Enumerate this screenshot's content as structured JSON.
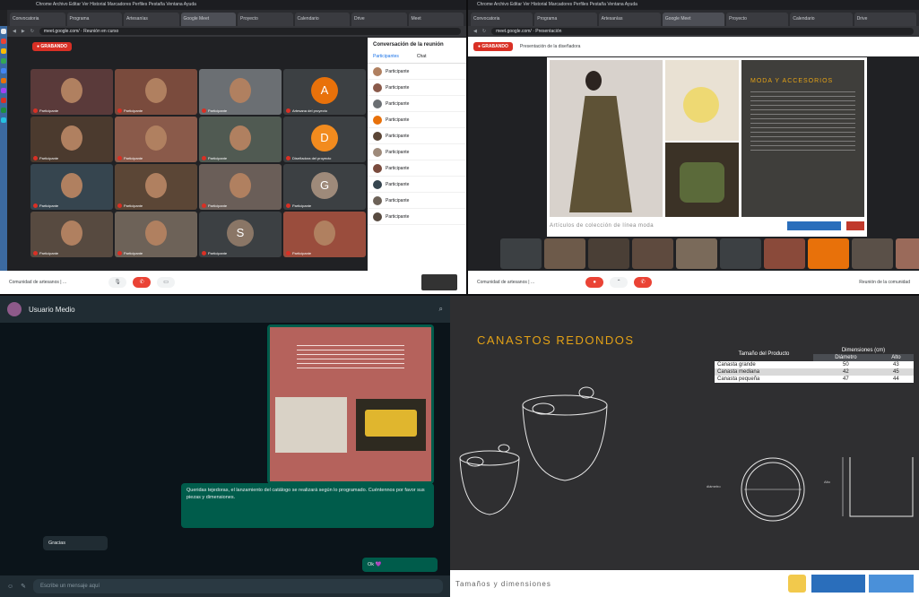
{
  "colors": {
    "accent": "#d93025",
    "chat_out": "#005c4b",
    "slide_title": "#e4a216"
  },
  "q1": {
    "menubar": "Chrome   Archivo   Editar   Ver   Historial   Marcadores   Perfiles   Pestaña   Ventana   Ayuda",
    "tabs": [
      "Convocatoria",
      "Programa",
      "Artesanías",
      "Google Meet",
      "Proyecto",
      "Calendario",
      "Drive",
      "Meet"
    ],
    "url": "meet.google.com/ · Reunión en curso",
    "rec": "● GRABANDO",
    "tiles": [
      {
        "name": "Participante",
        "type": "video",
        "bg": "#5a3a3a"
      },
      {
        "name": "Participante",
        "type": "video",
        "bg": "#7a4b3d"
      },
      {
        "name": "Participante",
        "type": "video",
        "bg": "#6b6f73"
      },
      {
        "name": "Artesana del proyecto",
        "type": "avatar",
        "letter": "A",
        "color": "#e8710a"
      },
      {
        "name": "Participante",
        "type": "video",
        "bg": "#4b3a2e"
      },
      {
        "name": "Participante",
        "type": "video",
        "bg": "#8a5a4a"
      },
      {
        "name": "Participante",
        "type": "video",
        "bg": "#505a52"
      },
      {
        "name": "Diseñadora del proyecto",
        "type": "avatar",
        "letter": "D",
        "color": "#f28b1e"
      },
      {
        "name": "Participante",
        "type": "video",
        "bg": "#36454f"
      },
      {
        "name": "Participante",
        "type": "video",
        "bg": "#5b4636"
      },
      {
        "name": "Participante",
        "type": "video",
        "bg": "#6a5e58"
      },
      {
        "name": "Participante",
        "type": "avatar",
        "letter": "G",
        "color": "#9e8a7a"
      },
      {
        "name": "Participante",
        "type": "video",
        "bg": "#574a40"
      },
      {
        "name": "Participante",
        "type": "video",
        "bg": "#6d6258"
      },
      {
        "name": "Participante",
        "type": "avatar",
        "letter": "S",
        "color": "#8a7666"
      },
      {
        "name": "Participante",
        "type": "video",
        "bg": "#9a4d3d"
      }
    ],
    "meeting_name": "Comunidad de artesanos | ...",
    "panel_title": "Conversación de la reunión",
    "panel_tabs": [
      "Participantes",
      "Chat"
    ],
    "panel_people": [
      "Participante",
      "Participante",
      "Participante",
      "Participante",
      "Participante",
      "Participante",
      "Participante",
      "Participante",
      "Participante",
      "Participante"
    ]
  },
  "q2": {
    "url": "meet.google.com/ · Presentación",
    "rec": "● GRABANDO",
    "presenter": "Presentación de la diseñadora",
    "slide_title": "MODA Y ACCESORIOS",
    "slide_caption": "Artículos de colección de línea moda",
    "meeting_name": "Comunidad de artesanos | ...",
    "people_btn": "Reunión de la comunidad"
  },
  "q3": {
    "contact": "Usuario Medio",
    "msg_out": "Queridas tejedoras, el lanzamiento del catálogo se realizará según lo programado. Cuéntennos por favor sus piezas y dimensiones.",
    "msg_in": "Gracias",
    "msg_out2": "Ok 💜",
    "input_placeholder": "Escribe un mensaje aquí"
  },
  "q4": {
    "title": "CANASTOS REDONDOS",
    "footer": "Tamaños y dimensiones",
    "table": {
      "head1": "Tamaño del Producto",
      "head2": "Dimensiones (cm)",
      "sub": [
        "Diámetro",
        "Alto"
      ],
      "rows": [
        [
          "Canasta grande",
          "50",
          "43"
        ],
        [
          "Canasta mediana",
          "42",
          "45"
        ],
        [
          "Canasta pequeña",
          "47",
          "44"
        ]
      ]
    },
    "label_diameter": "diámetro",
    "label_height": "Alto"
  }
}
